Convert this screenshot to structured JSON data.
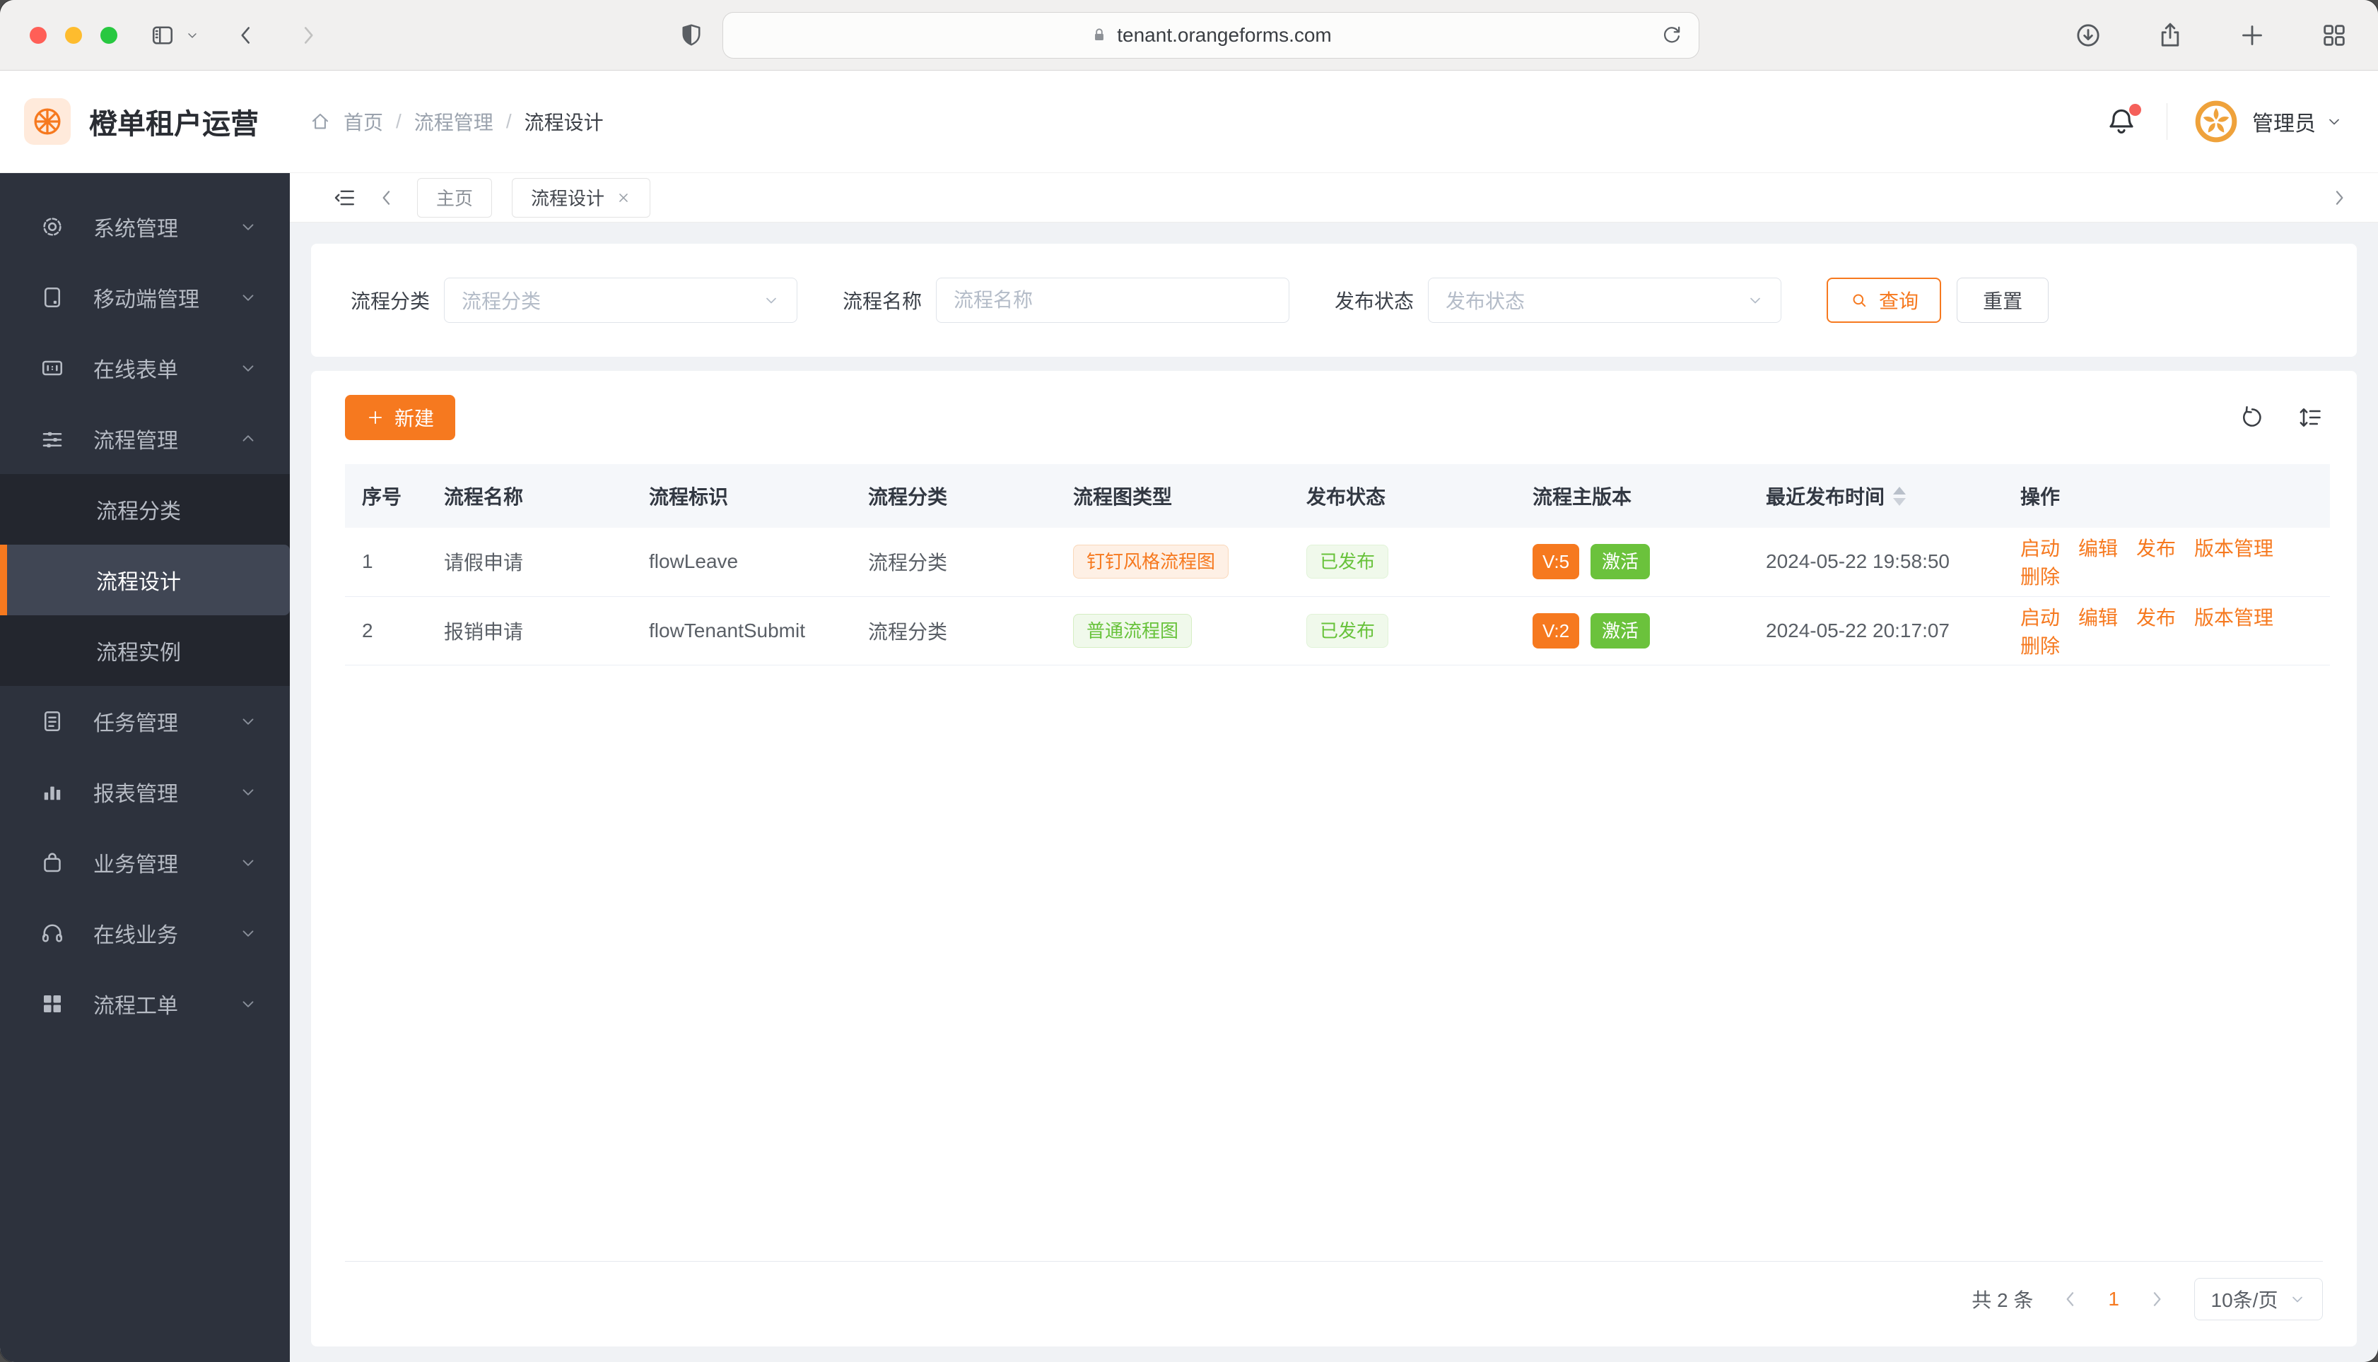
{
  "colors": {
    "primary": "#f6791f",
    "success": "#67c23a",
    "sidebar_bg": "#2d323d",
    "sidebar_submenu_bg": "#23262e",
    "sidebar_active_bg": "#404654",
    "content_bg": "#f0f2f5",
    "table_header_bg": "#f5f7fa",
    "notification_dot": "#f5605a"
  },
  "browser": {
    "url": "tenant.orangeforms.com"
  },
  "header": {
    "app_title": "橙单租户运营",
    "breadcrumb": [
      "首页",
      "流程管理",
      "流程设计"
    ],
    "user_name": "管理员"
  },
  "sidebar": {
    "items": [
      {
        "name": "system-management",
        "icon": "gear",
        "label": "系统管理"
      },
      {
        "name": "mobile-management",
        "icon": "mobile",
        "label": "移动端管理"
      },
      {
        "name": "online-forms",
        "icon": "form",
        "label": "在线表单"
      },
      {
        "name": "process-management",
        "icon": "flow",
        "label": "流程管理",
        "expanded": true,
        "children": [
          {
            "name": "process-category",
            "label": "流程分类"
          },
          {
            "name": "process-design",
            "label": "流程设计",
            "active": true
          },
          {
            "name": "process-instance",
            "label": "流程实例"
          }
        ]
      },
      {
        "name": "task-management",
        "icon": "task",
        "label": "任务管理"
      },
      {
        "name": "report-management",
        "icon": "chart",
        "label": "报表管理"
      },
      {
        "name": "business-management",
        "icon": "bag",
        "label": "业务管理"
      },
      {
        "name": "online-business",
        "icon": "headset",
        "label": "在线业务"
      },
      {
        "name": "process-workorder",
        "icon": "grid-fill",
        "label": "流程工单"
      }
    ]
  },
  "tabs": [
    {
      "label": "主页",
      "active": false,
      "closable": false
    },
    {
      "label": "流程设计",
      "active": true,
      "closable": true
    }
  ],
  "filters": {
    "fields": [
      {
        "name": "process-category",
        "label": "流程分类",
        "placeholder": "流程分类",
        "type": "select"
      },
      {
        "name": "process-name",
        "label": "流程名称",
        "placeholder": "流程名称",
        "type": "input"
      },
      {
        "name": "publish-status",
        "label": "发布状态",
        "placeholder": "发布状态",
        "type": "select"
      }
    ],
    "search_label": "查询",
    "reset_label": "重置"
  },
  "toolbar": {
    "new_label": "新建"
  },
  "table": {
    "columns": [
      "序号",
      "流程名称",
      "流程标识",
      "流程分类",
      "流程图类型",
      "发布状态",
      "流程主版本",
      "最近发布时间",
      "操作"
    ],
    "sortable_column": "最近发布时间",
    "rows": [
      {
        "index": "1",
        "name": "请假申请",
        "key": "flowLeave",
        "category": "流程分类",
        "diagram": {
          "label": "钉钉风格流程图",
          "variant": "orange"
        },
        "status": "已发布",
        "version": "V:5",
        "active_tag": "激活",
        "published_at": "2024-05-22 19:58:50"
      },
      {
        "index": "2",
        "name": "报销申请",
        "key": "flowTenantSubmit",
        "category": "流程分类",
        "diagram": {
          "label": "普通流程图",
          "variant": "green"
        },
        "status": "已发布",
        "version": "V:2",
        "active_tag": "激活",
        "published_at": "2024-05-22 20:17:07"
      }
    ],
    "row_actions": [
      {
        "name": "start",
        "label": "启动"
      },
      {
        "name": "edit",
        "label": "编辑"
      },
      {
        "name": "publish",
        "label": "发布"
      },
      {
        "name": "version-manage",
        "label": "版本管理"
      },
      {
        "name": "delete",
        "label": "删除"
      }
    ]
  },
  "pagination": {
    "total": "共 2 条",
    "current_page": "1",
    "page_size": "10条/页"
  }
}
